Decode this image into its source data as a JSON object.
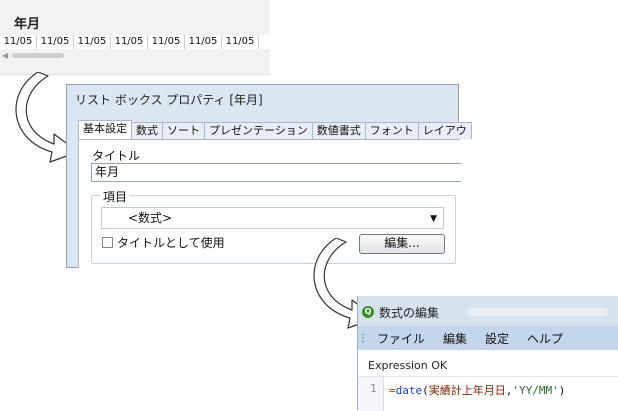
{
  "listbox": {
    "title": "年月",
    "values": [
      "11/05",
      "11/05",
      "11/05",
      "11/05",
      "11/05",
      "11/05",
      "11/05",
      "11/"
    ]
  },
  "properties_dialog": {
    "title": "リスト ボックス プロパティ [年月]",
    "tabs": [
      "基本設定",
      "数式",
      "ソート",
      "プレゼンテーション",
      "数値書式",
      "フォント",
      "レイアウ"
    ],
    "active_tab": "基本設定",
    "title_label": "タイトル",
    "title_value": "年月",
    "field_group_label": "項目",
    "field_select_value": "<数式>",
    "use_as_title_label": "タイトルとして使用",
    "use_as_title_checked": false,
    "edit_button_label": "編集..."
  },
  "expression_editor": {
    "title": "数式の編集",
    "menu": [
      "ファイル",
      "編集",
      "設定",
      "ヘルプ"
    ],
    "status": "Expression OK",
    "line_number": "1",
    "code": {
      "prefix": "=",
      "function": "date",
      "open": "(",
      "field": "実績計上年月日",
      "comma": ",",
      "format": "'YY/MM'",
      "close": ")"
    }
  },
  "colors": {
    "dialog_bg": "#dce6f3",
    "menubar_bg": "#c4d6ec",
    "app_icon": "#3b8f2a"
  }
}
